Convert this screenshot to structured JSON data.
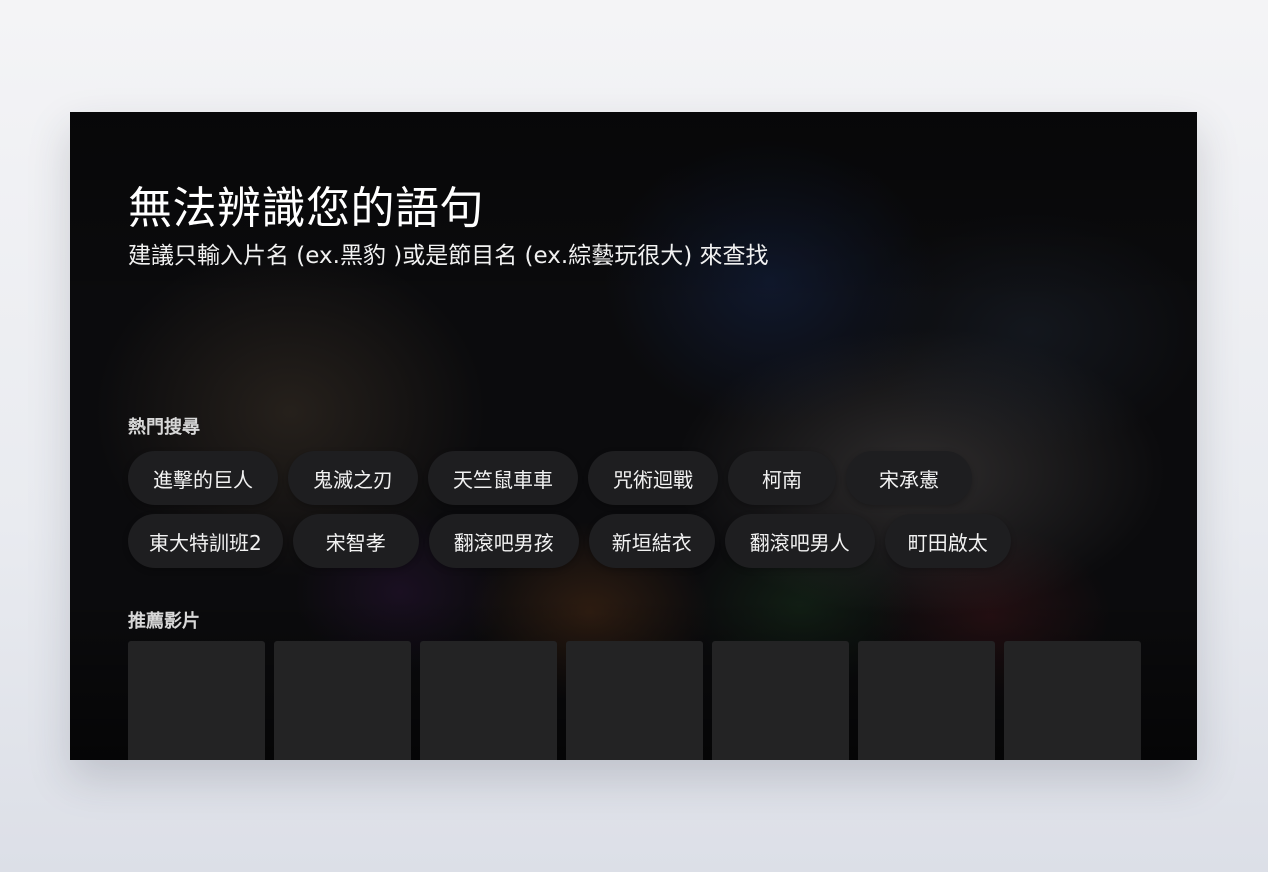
{
  "header": {
    "title": "無法辨識您的語句",
    "subtitle": "建議只輸入片名 (ex.黑豹 )或是節目名 (ex.綜藝玩很大) 來查找"
  },
  "hot_searches": {
    "label": "熱門搜尋",
    "row1": [
      "進擊的巨人",
      "鬼滅之刃",
      "天竺鼠車車",
      "咒術迴戰",
      "柯南",
      "宋承憲"
    ],
    "row2": [
      "東大特訓班2",
      "宋智孝",
      "翻滾吧男孩",
      "新垣結衣",
      "翻滾吧男人",
      "町田啟太"
    ]
  },
  "recommended": {
    "label": "推薦影片",
    "poster_count": 7
  }
}
